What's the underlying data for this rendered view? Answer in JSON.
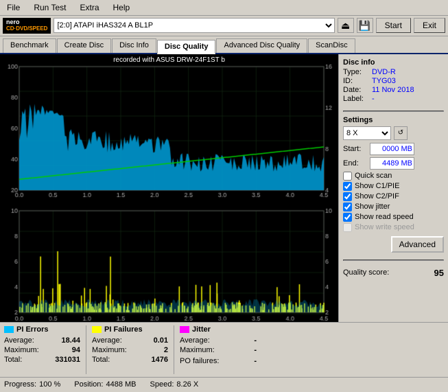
{
  "app": {
    "title": "Nero CD-DVD Speed"
  },
  "menu": {
    "items": [
      "File",
      "Run Test",
      "Extra",
      "Help"
    ]
  },
  "toolbar": {
    "logo_line1": "nero",
    "logo_line2": "CD·DVD/SPEED",
    "drive": "[2:0]  ATAPI iHAS324  A BL1P",
    "start_label": "Start",
    "close_label": "Exit"
  },
  "tabs": [
    {
      "label": "Benchmark",
      "active": false
    },
    {
      "label": "Create Disc",
      "active": false
    },
    {
      "label": "Disc Info",
      "active": false
    },
    {
      "label": "Disc Quality",
      "active": true
    },
    {
      "label": "Advanced Disc Quality",
      "active": false
    },
    {
      "label": "ScanDisc",
      "active": false
    }
  ],
  "chart": {
    "title": "recorded with ASUS   DRW-24F1ST  b",
    "top_y_left": [
      "100",
      "80",
      "60",
      "40",
      "20"
    ],
    "top_y_right": [
      "16",
      "12",
      "8",
      "4"
    ],
    "bottom_y_left": [
      "10",
      "8",
      "6",
      "4",
      "2"
    ],
    "bottom_y_right": [
      "10",
      "8",
      "6",
      "4",
      "2"
    ],
    "x_labels": [
      "0.0",
      "0.5",
      "1.0",
      "1.5",
      "2.0",
      "2.5",
      "3.0",
      "3.5",
      "4.0",
      "4.5"
    ]
  },
  "disc_info": {
    "title": "Disc info",
    "type_label": "Type:",
    "type_value": "DVD-R",
    "id_label": "ID:",
    "id_value": "TYG03",
    "date_label": "Date:",
    "date_value": "11 Nov 2018",
    "label_label": "Label:",
    "label_value": "-"
  },
  "settings": {
    "title": "Settings",
    "speed_value": "8 X",
    "start_label": "Start:",
    "start_value": "0000 MB",
    "end_label": "End:",
    "end_value": "4489 MB",
    "quick_scan": {
      "label": "Quick scan",
      "checked": false
    },
    "show_c1pie": {
      "label": "Show C1/PIE",
      "checked": true
    },
    "show_c2pif": {
      "label": "Show C2/PIF",
      "checked": true
    },
    "show_jitter": {
      "label": "Show jitter",
      "checked": true
    },
    "show_read_speed": {
      "label": "Show read speed",
      "checked": true
    },
    "show_write_speed": {
      "label": "Show write speed",
      "checked": false,
      "disabled": true
    },
    "advanced_label": "Advanced"
  },
  "quality": {
    "score_label": "Quality score:",
    "score_value": "95"
  },
  "stats": {
    "pi_errors": {
      "label": "PI Errors",
      "color": "#00bfff",
      "average_label": "Average:",
      "average_value": "18.44",
      "maximum_label": "Maximum:",
      "maximum_value": "94",
      "total_label": "Total:",
      "total_value": "331031"
    },
    "pi_failures": {
      "label": "PI Failures",
      "color": "#ffff00",
      "average_label": "Average:",
      "average_value": "0.01",
      "maximum_label": "Maximum:",
      "maximum_value": "2",
      "total_label": "Total:",
      "total_value": "1476"
    },
    "jitter": {
      "label": "Jitter",
      "color": "#ff00ff",
      "average_label": "Average:",
      "average_value": "-",
      "maximum_label": "Maximum:",
      "maximum_value": "-"
    },
    "po_failures": {
      "label": "PO failures:",
      "value": "-"
    }
  },
  "progress": {
    "progress_label": "Progress:",
    "progress_value": "100 %",
    "position_label": "Position:",
    "position_value": "4488 MB",
    "speed_label": "Speed:",
    "speed_value": "8.26 X"
  }
}
